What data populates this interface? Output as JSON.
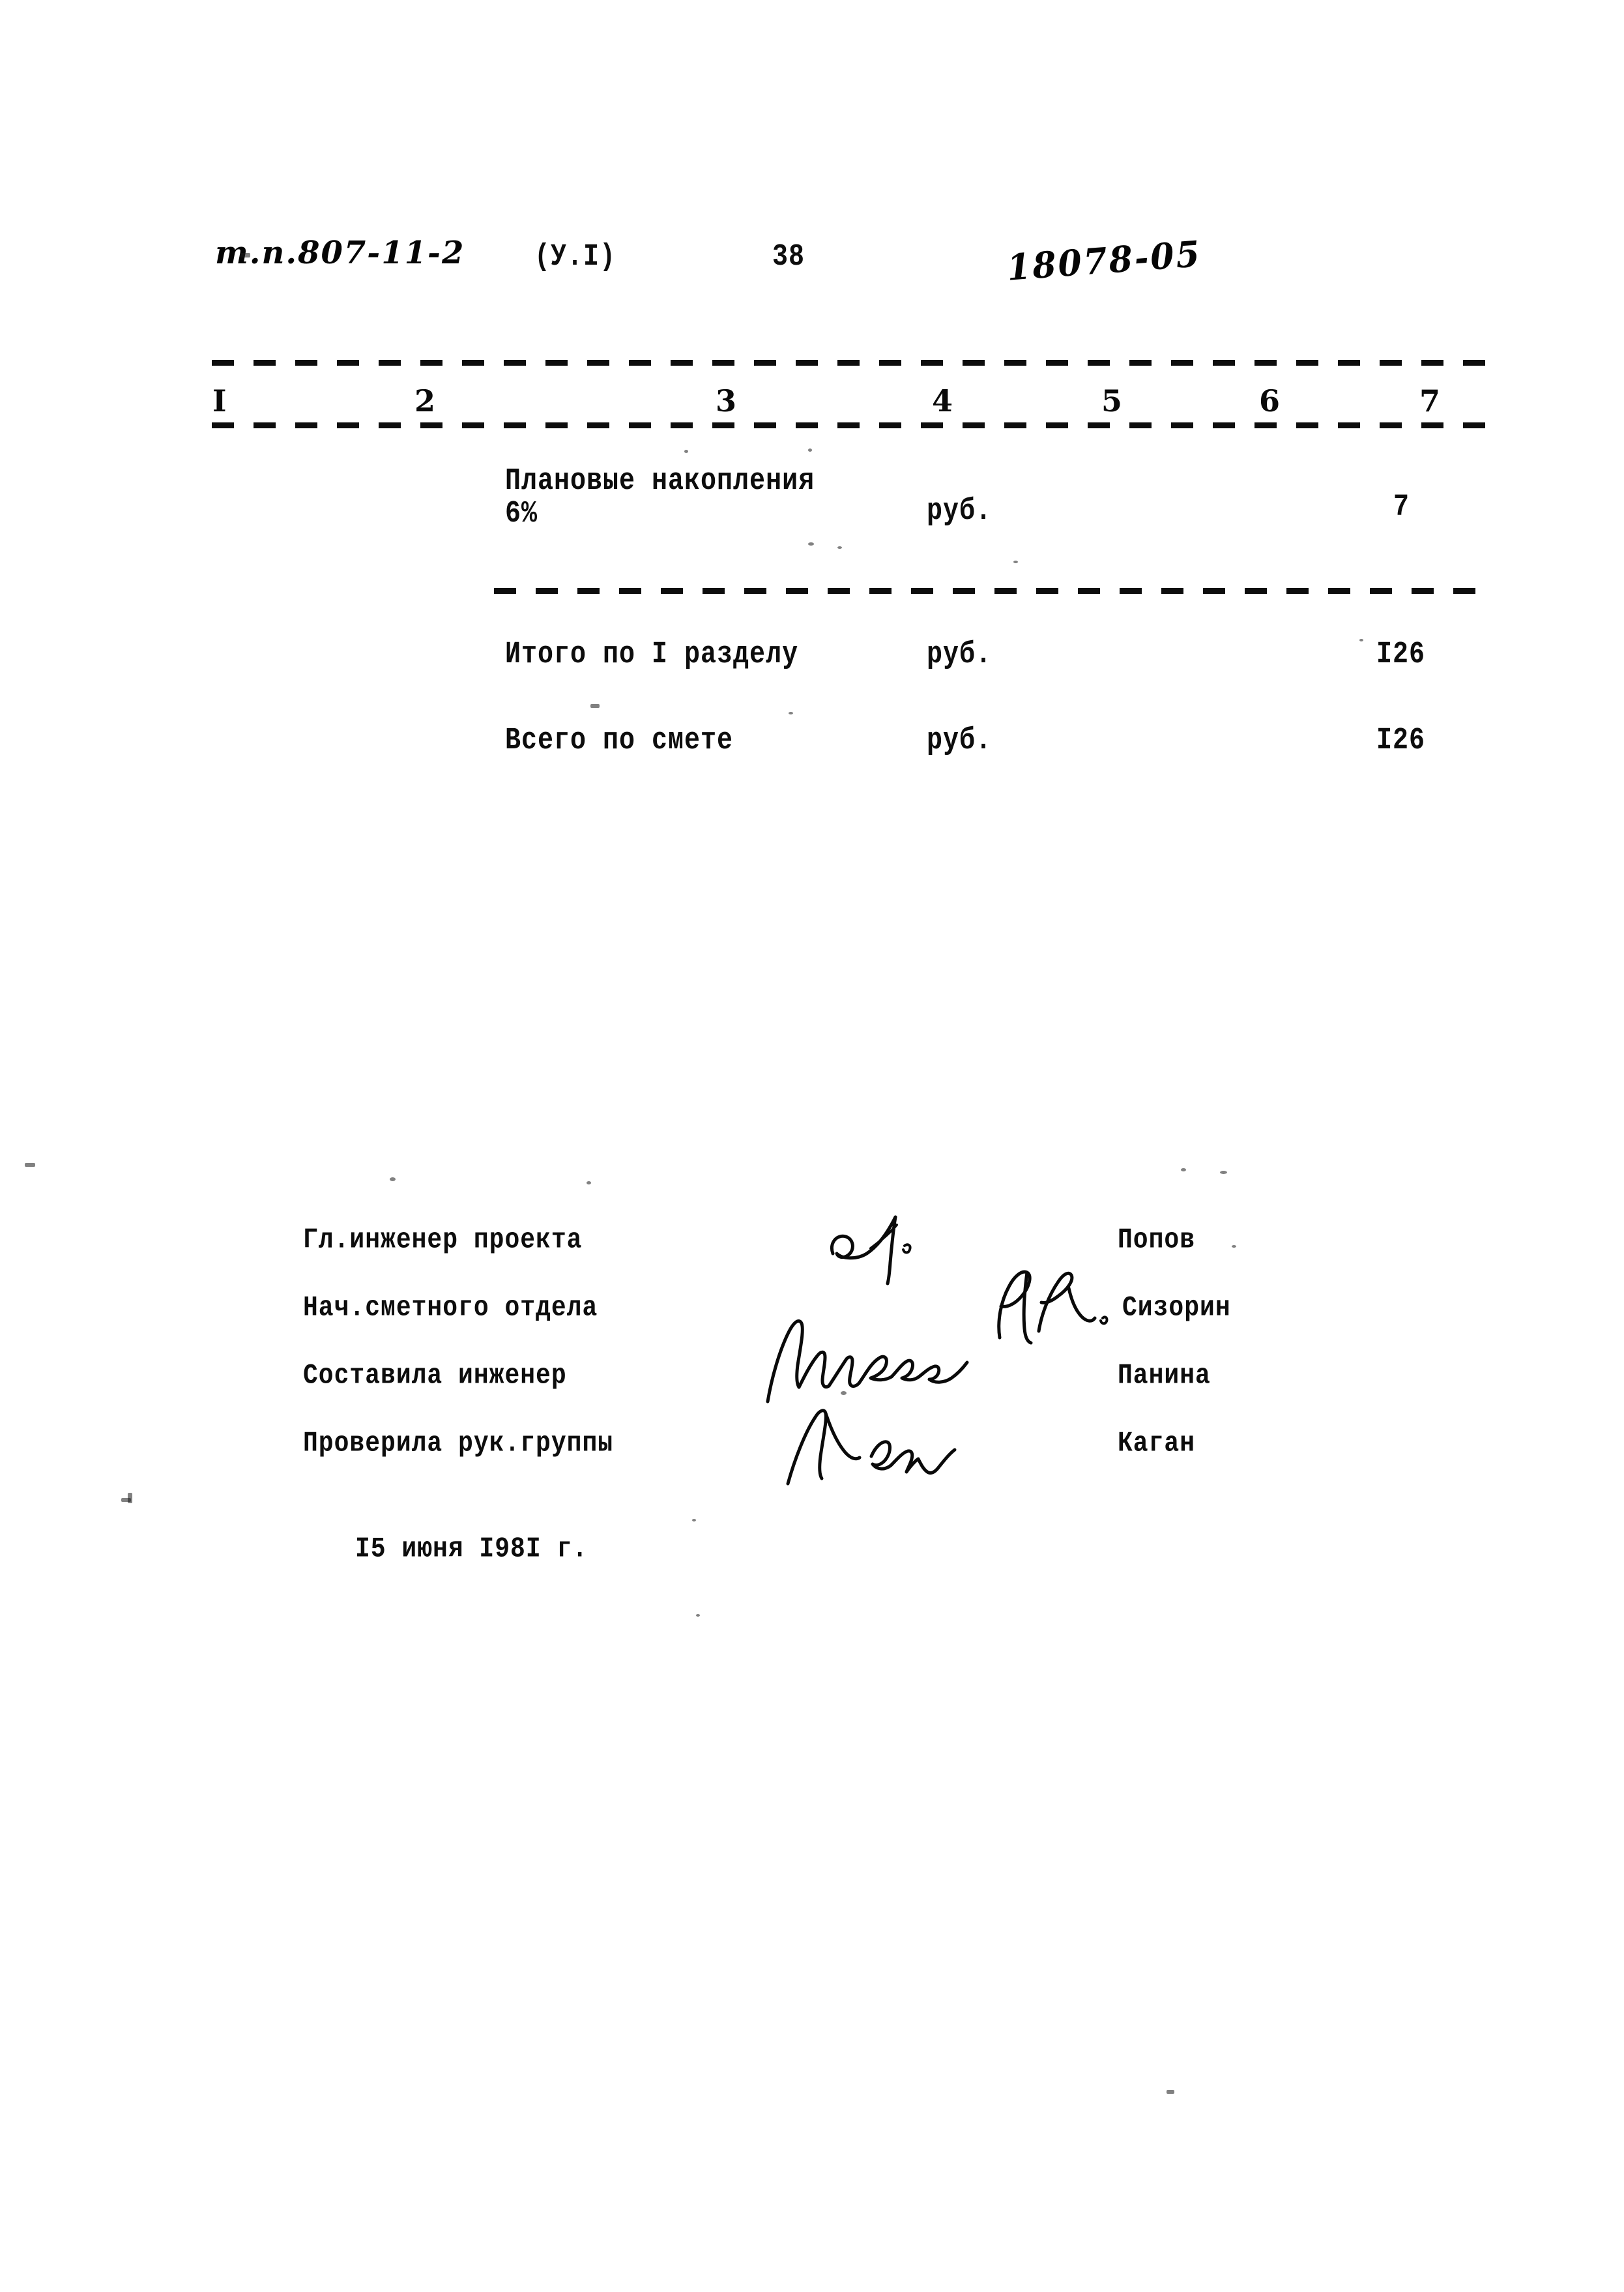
{
  "document": {
    "type": "construction-estimate-sheet",
    "language": "ru"
  },
  "header": {
    "project_code": "т.п.807-11-2",
    "volume_ref": "(У.I)",
    "page_number": "38",
    "archive_number": "18078-05"
  },
  "table": {
    "column_numbers": [
      "I",
      "2",
      "3",
      "4",
      "5",
      "6",
      "7"
    ],
    "rows": [
      {
        "kind": "item",
        "col1": "",
        "description": "Плановые накопления",
        "description_line2": "6%",
        "unit": "руб.",
        "col4": "",
        "col5": "",
        "col6": "",
        "amount": "7"
      },
      {
        "kind": "subtotal",
        "col1": "",
        "description": "Итого по I разделу",
        "description_line2": "",
        "unit": "руб.",
        "col4": "",
        "col5": "",
        "col6": "",
        "amount": "I26"
      },
      {
        "kind": "total",
        "col1": "",
        "description": "Всего по смете",
        "description_line2": "",
        "unit": "руб.",
        "col4": "",
        "col5": "",
        "col6": "",
        "amount": "I26"
      }
    ]
  },
  "signatures": {
    "rows": [
      {
        "role": "Гл.инженер проекта",
        "name": "Попов",
        "signature": "signature-mark-popov"
      },
      {
        "role": "Нач.сметного отдела",
        "name": "Сизорин",
        "signature": "signature-mark-sizorin"
      },
      {
        "role": "Составила инженер",
        "name": "Панина",
        "signature": "signature-mark-mikheeva"
      },
      {
        "role": "Проверила рук.группы",
        "name": "Каган",
        "signature": "signature-mark-kagan"
      }
    ]
  },
  "footer": {
    "date": "I5 июня I98I г."
  },
  "colors": {
    "ink": "#0d0d0d",
    "pen": "#0a0a0a",
    "paper": "#ffffff"
  }
}
